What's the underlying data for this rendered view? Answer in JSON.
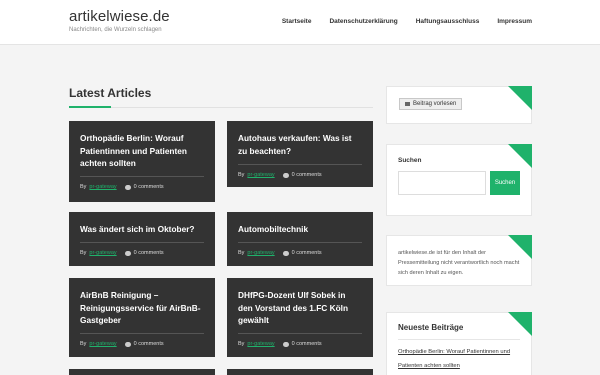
{
  "site": {
    "title": "artikelwiese.de",
    "tagline": "Nachrichten, die Wurzeln schlagen"
  },
  "nav": {
    "items": [
      {
        "label": "Startseite"
      },
      {
        "label": "Datenschutzerklärung"
      },
      {
        "label": "Haftungsausschluss"
      },
      {
        "label": "Impressum"
      }
    ]
  },
  "main": {
    "section_title": "Latest Articles",
    "articles": [
      {
        "title": "Orthopädie Berlin: Worauf Patientinnen und Patienten achten sollten",
        "by": "By",
        "author": "pr-gateway",
        "comments": "0 comments"
      },
      {
        "title": "Autohaus verkaufen: Was ist zu beachten?",
        "by": "By",
        "author": "pr-gateway",
        "comments": "0 comments"
      },
      {
        "title": "Was ändert sich im Oktober?",
        "by": "By",
        "author": "pr-gateway",
        "comments": "0 comments"
      },
      {
        "title": "Automobiltechnik",
        "by": "By",
        "author": "pr-gateway",
        "comments": "0 comments"
      },
      {
        "title": "AirBnB Reinigung – Reinigungsservice für AirBnB-Gastgeber",
        "by": "By",
        "author": "pr-gateway",
        "comments": "0 comments"
      },
      {
        "title": "DHfPG-Dozent Ulf Sobek in den Vorstand des 1.FC Köln gewählt",
        "by": "By",
        "author": "pr-gateway",
        "comments": "0 comments"
      }
    ]
  },
  "sidebar": {
    "read_button": "Beitrag vorlesen",
    "search": {
      "label": "Suchen",
      "button": "Suchen",
      "value": ""
    },
    "info_text": "artikelwiese.de ist für den Inhalt der Pressemitteilung nicht verantwortlich noch macht sich deren Inhalt zu eigen.",
    "recent": {
      "title": "Neueste Beiträge",
      "links": [
        "Orthopädie Berlin: Worauf Patientinnen und Patienten achten sollten"
      ]
    }
  },
  "colors": {
    "accent": "#1fb26b",
    "card": "#333333",
    "background": "#f4f4f4"
  }
}
